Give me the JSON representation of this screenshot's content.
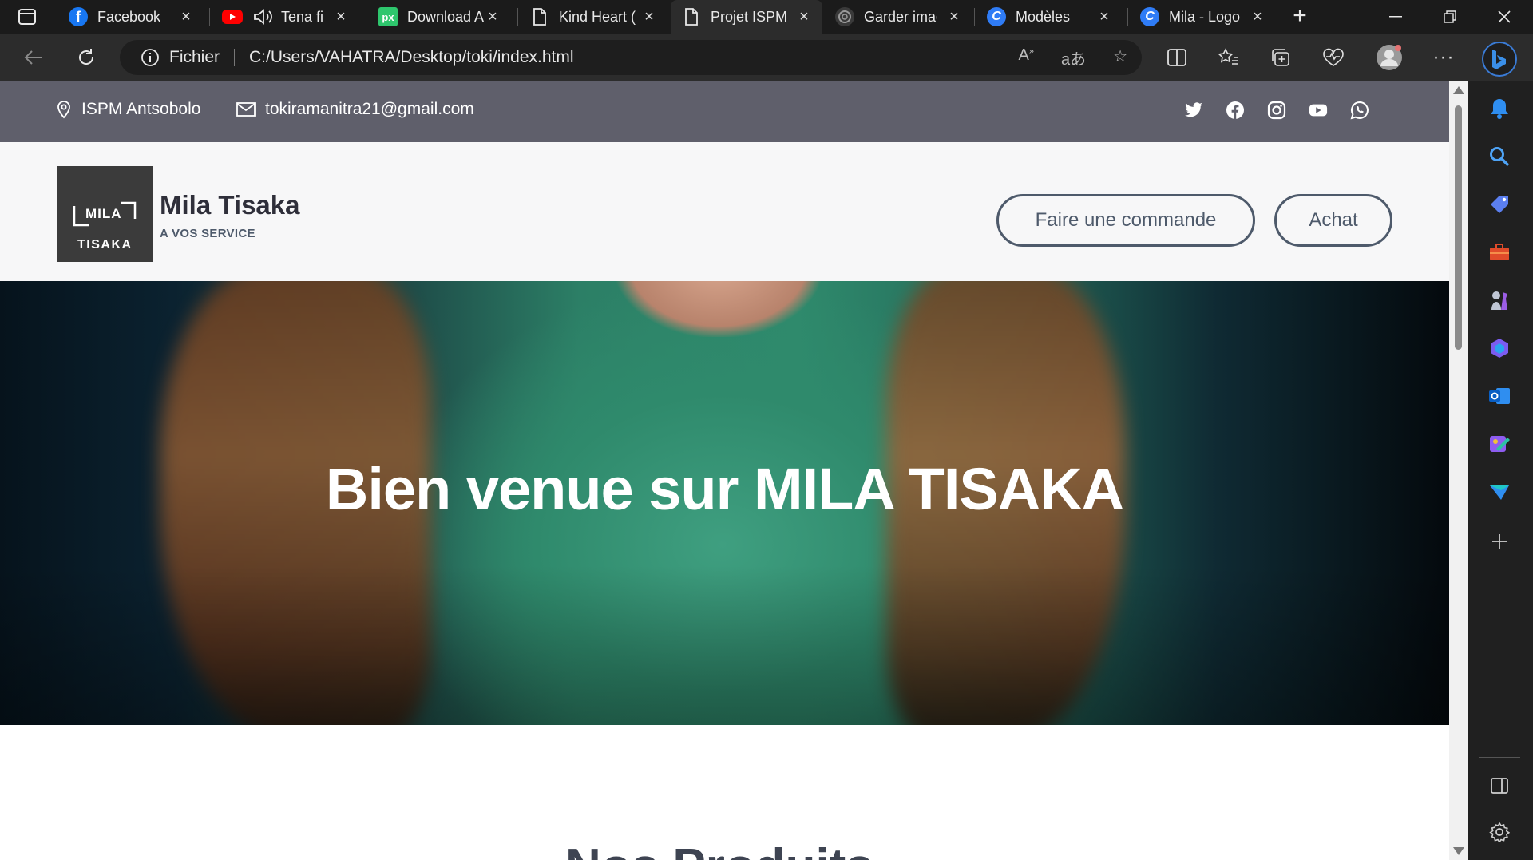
{
  "browser": {
    "tabs": [
      {
        "title": "Facebook",
        "icon": "facebook-icon",
        "color": "#1877f2"
      },
      {
        "title": "Tena fi",
        "icon": "youtube-icon",
        "color": "#ff0000",
        "audio": true
      },
      {
        "title": "Download A",
        "icon": "pixabay-icon",
        "color": "#2ec66d"
      },
      {
        "title": "Kind Heart (",
        "icon": "page-icon"
      },
      {
        "title": "Projet ISPM",
        "icon": "page-icon",
        "active": true
      },
      {
        "title": "Garder imag",
        "icon": "openai-icon"
      },
      {
        "title": "Modèles",
        "icon": "canva-icon",
        "color": "#2f7cf6"
      },
      {
        "title": "Mila - Logo",
        "icon": "canva-icon",
        "color": "#2f7cf6"
      }
    ],
    "address": {
      "scheme_label": "Fichier",
      "url": "C:/Users/VAHATRA/Desktop/toki/index.html"
    }
  },
  "site": {
    "topbar": {
      "location": "ISPM Antsobolo",
      "email": "tokiramanitra21@gmail.com",
      "socials": [
        "twitter-icon",
        "facebook-icon",
        "instagram-icon",
        "youtube-icon",
        "whatsapp-icon"
      ]
    },
    "header": {
      "logo_line1": "MILA",
      "logo_line2": "TISAKA",
      "brand_name": "Mila Tisaka",
      "tagline": "A VOS SERVICE",
      "order_button": "Faire une commande",
      "buy_button": "Achat"
    },
    "hero": {
      "heading": "Bien venue sur MILA TISAKA"
    },
    "next_section_title": "Nos Produits"
  },
  "colors": {
    "topbar_bg": "#5f5f6b",
    "accent": "#4e5a6b",
    "header_bg": "#f7f7f8",
    "hero_shirt": "#2f8a6c"
  }
}
